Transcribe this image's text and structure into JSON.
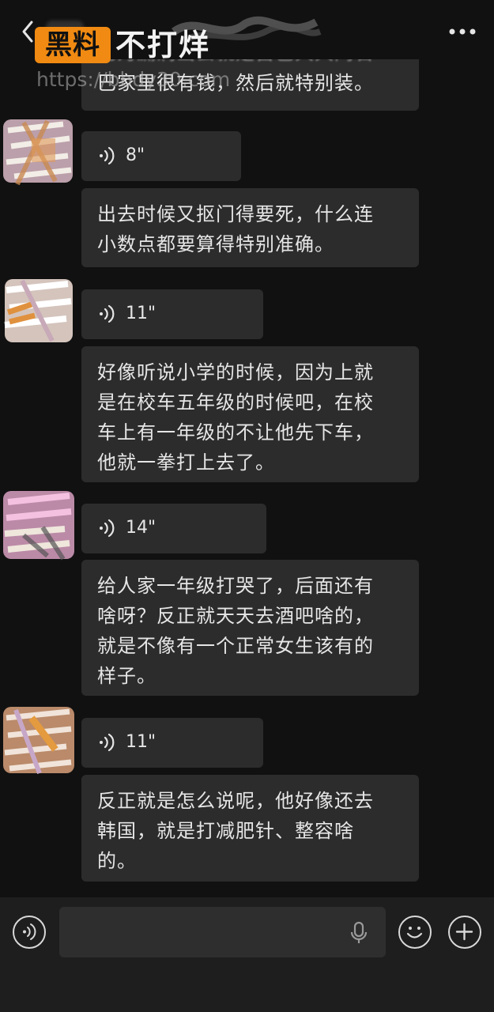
{
  "watermark": {
    "badge": "黑料",
    "title": "不打烊",
    "url": "https://bbdy30.com"
  },
  "header": {
    "back_icon": "chevron-left-icon",
    "more_icon": "more-dots-icon"
  },
  "messages": [
    {
      "type": "text",
      "lines": [
        "巴家里很有钱，然后就特别装。"
      ],
      "partial_top": "也为漏洞出去就是自己大大同石"
    },
    {
      "type": "voice",
      "duration": "8\""
    },
    {
      "type": "text",
      "lines": [
        "出去时候又抠门得要死，什么连",
        "小数点都要算得特别准确。"
      ]
    },
    {
      "type": "voice",
      "duration": "11\""
    },
    {
      "type": "text",
      "lines": [
        "好像听说小学的时候，因为上就",
        "是在校车五年级的时候吧，在校",
        "车上有一年级的不让他先下车，",
        "他就一拳打上去了。"
      ]
    },
    {
      "type": "voice",
      "duration": "14\""
    },
    {
      "type": "text",
      "lines": [
        "给人家一年级打哭了，后面还有",
        "啥呀？反正就天天去酒吧啥的，",
        "就是不像有一个正常女生该有的",
        "样子。"
      ]
    },
    {
      "type": "voice",
      "duration": "11\""
    },
    {
      "type": "text",
      "lines": [
        "反正就是怎么说呢，他好像还去",
        "韩国，就是打减肥针、整容啥",
        "的。"
      ]
    }
  ],
  "input_bar": {
    "placeholder": "",
    "voice_toggle_icon": "voice-mode-icon",
    "mic_icon": "microphone-icon",
    "emoji_icon": "emoji-icon",
    "plus_icon": "plus-icon"
  },
  "colors": {
    "background": "#111111",
    "bubble": "#2c2c2c",
    "text": "#e6e6e6",
    "watermark_badge": "#f08a12",
    "input_bar": "#1e1e1e"
  }
}
